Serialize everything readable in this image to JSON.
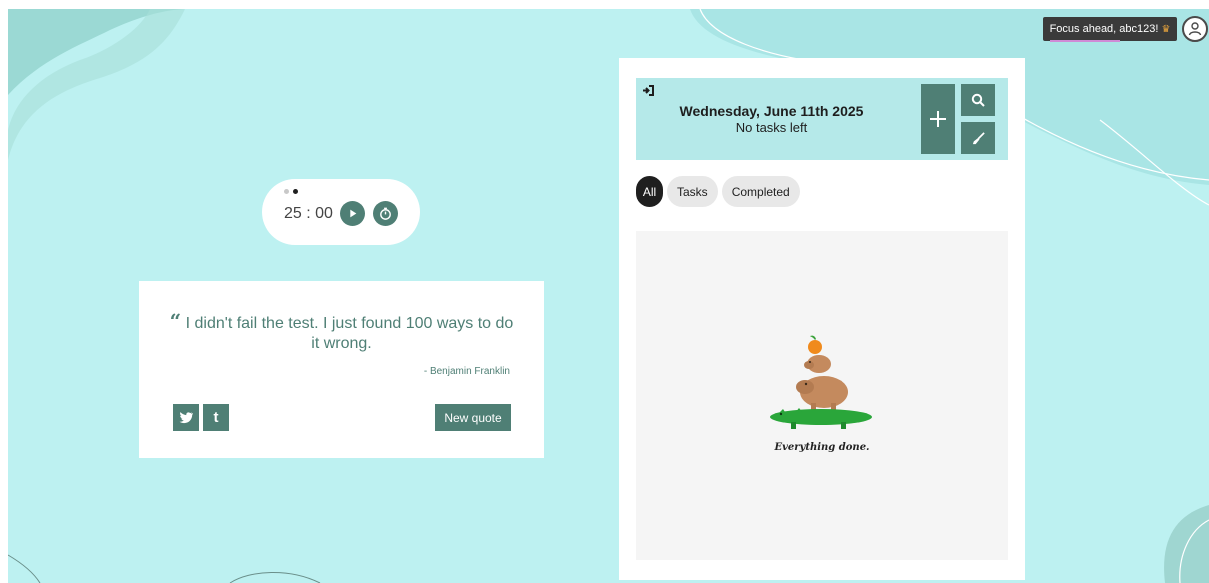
{
  "greeting": {
    "text": "Focus ahead, abc123!",
    "icon": "crown-icon"
  },
  "profile": {
    "icon": "user-icon"
  },
  "timer": {
    "time": "25 : 00",
    "modes": [
      "focus",
      "break"
    ],
    "play_icon": "play-icon",
    "reset_icon": "timer-reset-icon"
  },
  "quote": {
    "text": "I didn't fail the test. I just found 100 ways to do it wrong.",
    "author": "- Benjamin Franklin",
    "share_twitter_icon": "twitter-icon",
    "share_tumblr_label": "t",
    "new_quote_label": "New quote"
  },
  "tasks": {
    "date": "Wednesday, June 11th 2025",
    "status": "No tasks left",
    "header_icon": "sign-in-icon",
    "add_label": "+",
    "search_icon": "search-icon",
    "clear_icon": "broom-icon",
    "filters": [
      "All",
      "Tasks",
      "Completed"
    ],
    "active_filter": "All",
    "empty_message": "Everything done."
  },
  "colors": {
    "background": "#bdf1f1",
    "accent": "#4f7f75",
    "header_bg": "#b5e9e9",
    "dark": "#1f1f1f"
  }
}
